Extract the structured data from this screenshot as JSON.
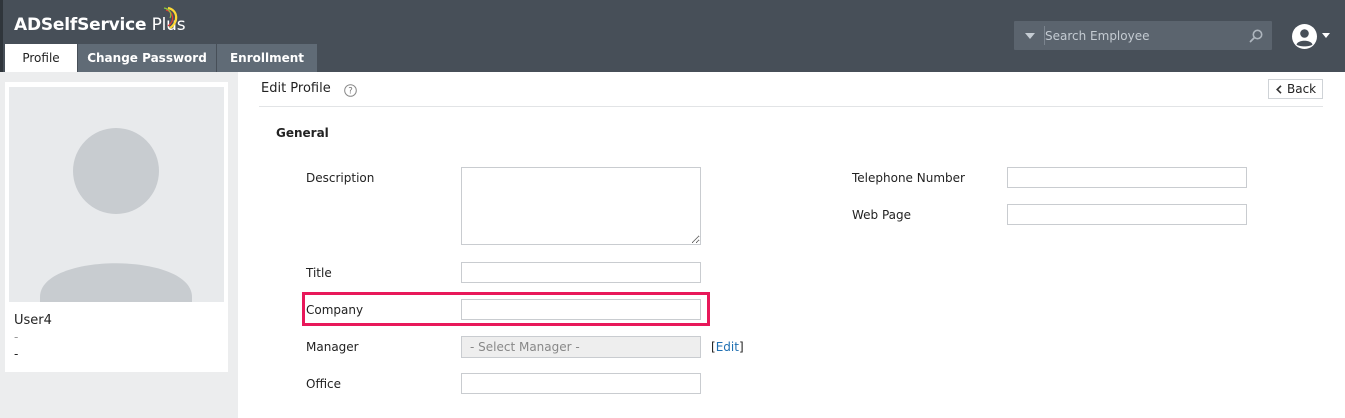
{
  "header": {
    "logo_name": "ADSelfService",
    "logo_suffix": "Plus",
    "tabs": [
      {
        "label": "Profile",
        "active": true
      },
      {
        "label": "Change Password",
        "active": false
      },
      {
        "label": "Enrollment",
        "active": false
      }
    ],
    "search": {
      "placeholder": "Search Employee",
      "value": ""
    }
  },
  "profile": {
    "username": "User4",
    "line2": "-",
    "line3": "-"
  },
  "main": {
    "title": "Edit Profile",
    "back_label": "Back",
    "section": "General",
    "fields": {
      "description": {
        "label": "Description",
        "value": ""
      },
      "title": {
        "label": "Title",
        "value": ""
      },
      "company": {
        "label": "Company",
        "value": ""
      },
      "manager": {
        "label": "Manager",
        "value": "- Select Manager -"
      },
      "office": {
        "label": "Office",
        "value": ""
      },
      "telephone": {
        "label": "Telephone Number",
        "value": ""
      },
      "webpage": {
        "label": "Web Page",
        "value": ""
      }
    },
    "edit_link": {
      "open": "[",
      "label": "Edit",
      "close": "]"
    }
  },
  "colors": {
    "header_bg": "#474f58",
    "tab_bg": "#606b76",
    "highlight": "#e8185a",
    "link": "#1f6fb2",
    "logo_arc_green": "#8cc63f",
    "logo_arc_red": "#e53935",
    "logo_arc_yellow": "#fdd835"
  },
  "icons": [
    "logo-arc-icon",
    "dropdown-caret-icon",
    "search-icon",
    "user-account-icon",
    "help-icon",
    "chevron-left-icon",
    "avatar-placeholder-icon"
  ]
}
